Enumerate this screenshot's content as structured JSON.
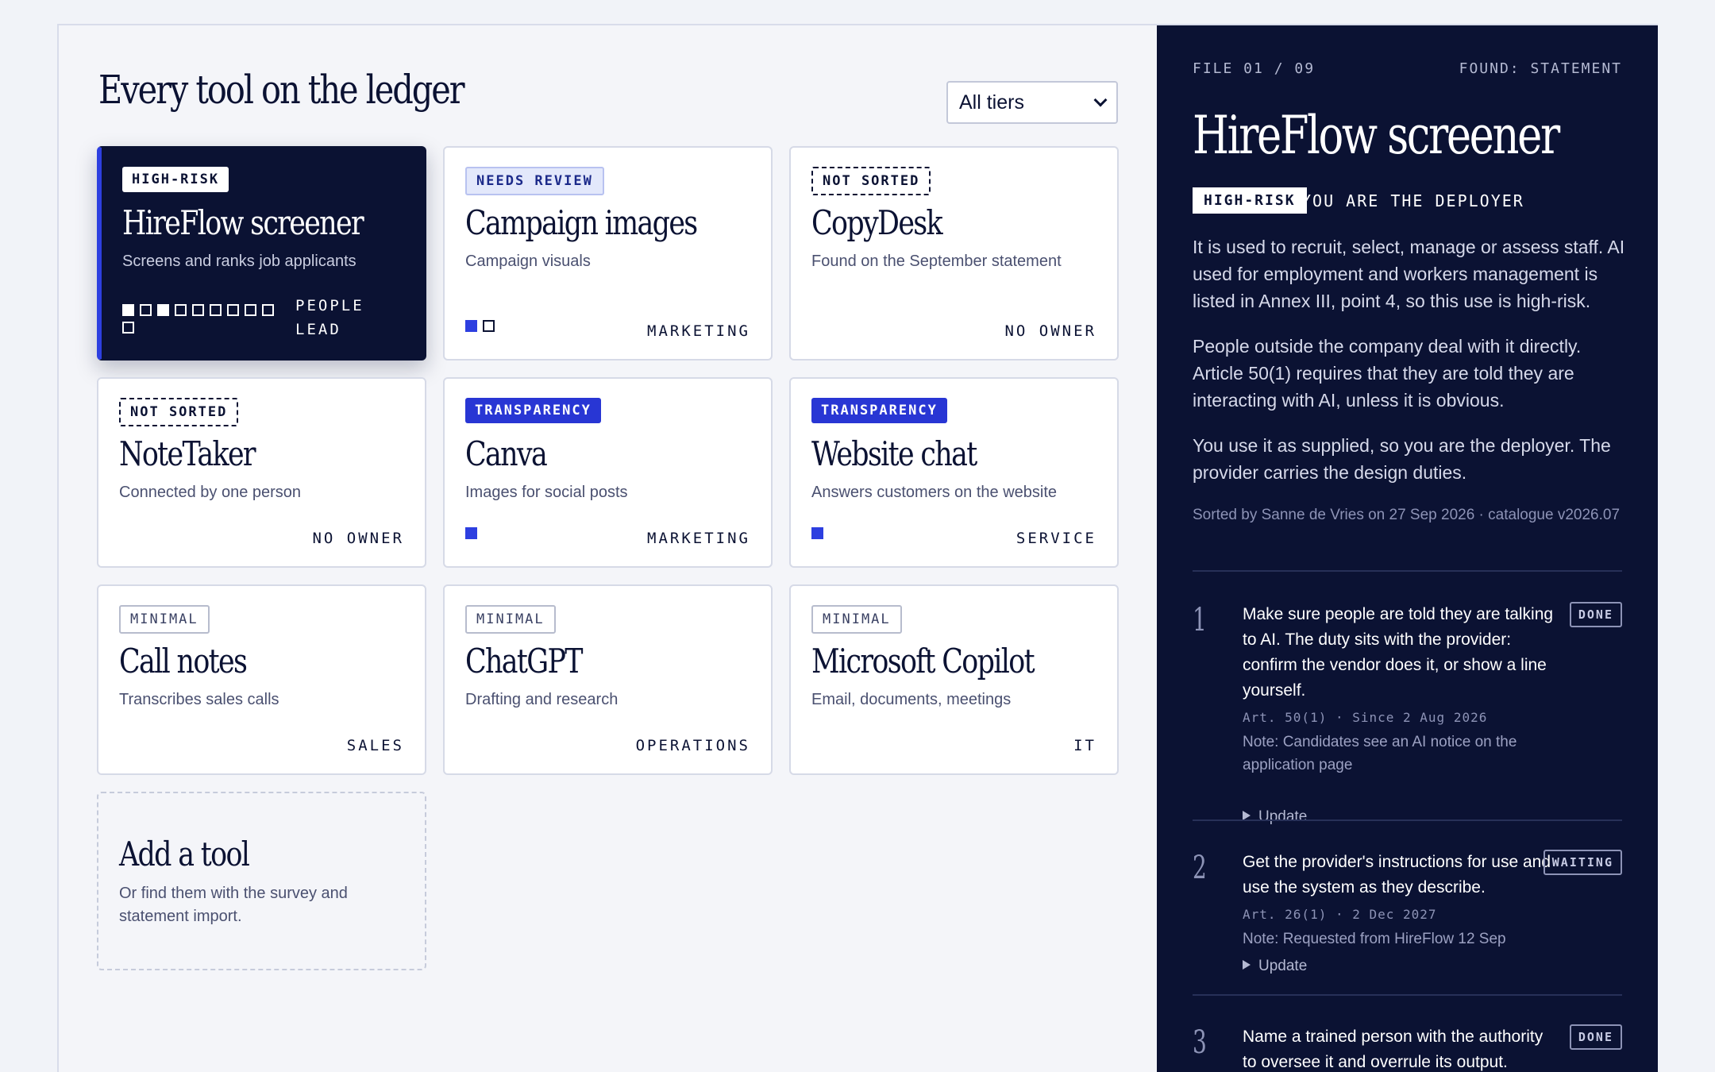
{
  "ledger": {
    "title": "Every tool on the ledger",
    "tier_filter": "All tiers"
  },
  "tools": [
    {
      "badge": "HIGH-RISK",
      "name": "HireFlow screener",
      "description": "Screens and ranks job applicants",
      "owner": "PEOPLE LEAD",
      "pips_filled": 3,
      "pips_total": 10
    },
    {
      "badge": "NEEDS REVIEW",
      "name": "Campaign images",
      "description": "Campaign visuals",
      "owner": "MARKETING",
      "pips_filled": 1,
      "pips_total": 2
    },
    {
      "badge": "NOT SORTED",
      "name": "CopyDesk",
      "description": "Found on the September statement",
      "owner": "NO OWNER"
    },
    {
      "badge": "NOT SORTED",
      "name": "NoteTaker",
      "description": "Connected by one person",
      "owner": "NO OWNER"
    },
    {
      "badge": "TRANSPARENCY",
      "name": "Canva",
      "description": "Images for social posts",
      "owner": "MARKETING",
      "pips_filled": 1,
      "pips_total": 1
    },
    {
      "badge": "TRANSPARENCY",
      "name": "Website chat",
      "description": "Answers customers on the website",
      "owner": "SERVICE",
      "pips_filled": 1,
      "pips_total": 1
    },
    {
      "badge": "MINIMAL",
      "name": "Call notes",
      "description": "Transcribes sales calls",
      "owner": "SALES"
    },
    {
      "badge": "MINIMAL",
      "name": "ChatGPT",
      "description": "Drafting and research",
      "owner": "OPERATIONS"
    },
    {
      "badge": "MINIMAL",
      "name": "Microsoft Copilot",
      "description": "Email, documents, meetings",
      "owner": "IT"
    }
  ],
  "add_tool": {
    "title": "Add a tool",
    "description": "Or find them with the survey and statement import."
  },
  "detail": {
    "file": "FILE 01 / 09",
    "found": "FOUND: STATEMENT",
    "name": "HireFlow screener",
    "badge": "HIGH-RISK",
    "role": "YOU ARE THE DEPLOYER",
    "paragraphs": [
      "It is used to recruit, select, manage or assess staff. AI used for employment and workers management is listed in Annex III, point 4, so this use is high-risk.",
      "People outside the company deal with it directly. Article 50(1) requires that they are told they are interacting with AI, unless it is obvious.",
      "You use it as supplied, so you are the deployer. The provider carries the design duties."
    ],
    "sorted_by": "Sorted by Sanne de Vries on 27 Sep 2026 · catalogue v2026.07",
    "duties": [
      {
        "num": "1",
        "text": "Make sure people are told they are talking to AI. The duty sits with the provider: confirm the vendor does it, or show a line yourself.",
        "status": "DONE",
        "article": "Art. 50(1) · Since 2 Aug 2026",
        "note": "Note: Candidates see an AI notice on the application page",
        "update": "Update"
      },
      {
        "num": "2",
        "text": "Get the provider's instructions for use and use the system as they describe.",
        "status": "WAITING",
        "article": "Art. 26(1) · 2 Dec 2027",
        "note": "Note: Requested from HireFlow 12 Sep",
        "update": "Update"
      },
      {
        "num": "3",
        "text": "Name a trained person with the authority to oversee it and overrule its output.",
        "status": "DONE"
      }
    ]
  },
  "colors": {
    "navy": "#0b1233",
    "accent": "#2d3fe0",
    "transparency": "#2836d4"
  }
}
